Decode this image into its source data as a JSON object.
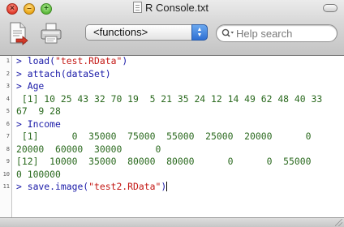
{
  "window": {
    "title": "R Console.txt"
  },
  "toolbar": {
    "functions_selected": "<functions>",
    "search_placeholder": "Help search"
  },
  "console_lines": [
    {
      "number": "1",
      "parts": [
        {
          "t": "> ",
          "k": "prompt"
        },
        {
          "t": "load(",
          "k": "cmd"
        },
        {
          "t": "\"test.RData\"",
          "k": "str"
        },
        {
          "t": ")",
          "k": "cmd"
        }
      ]
    },
    {
      "number": "2",
      "parts": [
        {
          "t": "> ",
          "k": "prompt"
        },
        {
          "t": "attach(dataSet)",
          "k": "cmd"
        }
      ]
    },
    {
      "number": "3",
      "parts": [
        {
          "t": "> ",
          "k": "prompt"
        },
        {
          "t": "Age",
          "k": "cmd"
        }
      ]
    },
    {
      "number": "4",
      "parts": [
        {
          "t": " [1] 10 25 43 32 70 19  5 21 35 24 12 14 49 62 48 40 33",
          "k": "out"
        }
      ]
    },
    {
      "number": "5",
      "parts": [
        {
          "t": "67  9 28",
          "k": "out"
        }
      ]
    },
    {
      "number": "6",
      "parts": [
        {
          "t": "> ",
          "k": "prompt"
        },
        {
          "t": "Income",
          "k": "cmd"
        }
      ]
    },
    {
      "number": "7",
      "parts": [
        {
          "t": " [1]      0  35000  75000  55000  25000  20000      0",
          "k": "out"
        }
      ]
    },
    {
      "number": "8",
      "parts": [
        {
          "t": "20000  60000  30000      0",
          "k": "out"
        }
      ]
    },
    {
      "number": "9",
      "parts": [
        {
          "t": "[12]  10000  35000  80000  80000      0      0  55000",
          "k": "out"
        }
      ]
    },
    {
      "number": "10",
      "parts": [
        {
          "t": "0 100000",
          "k": "out"
        }
      ]
    },
    {
      "number": "11",
      "parts": [
        {
          "t": "> ",
          "k": "prompt"
        },
        {
          "t": "save.image(",
          "k": "cmd"
        },
        {
          "t": "\"test2.RData\"",
          "k": "str"
        },
        {
          "t": ")",
          "k": "cmd"
        }
      ],
      "cursor": true
    }
  ],
  "colors": {
    "prompt": "#1a1aa8",
    "output": "#2b6a1f",
    "string": "#c41a16",
    "search_accent": "#2f6fd3"
  },
  "icons": {
    "source_button": "source-script-icon",
    "print_button": "printer-icon",
    "search": "magnifier-icon"
  }
}
